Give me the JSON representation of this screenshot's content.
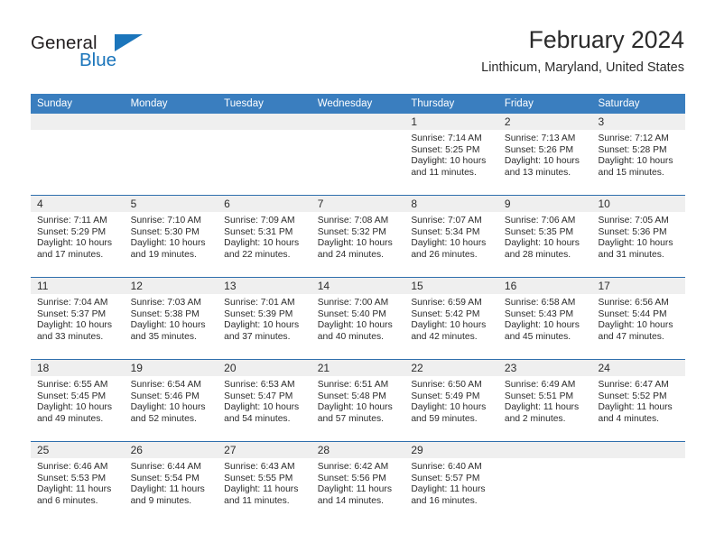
{
  "brand": {
    "name_primary": "General",
    "name_secondary": "Blue",
    "accent_color": "#1b75bb"
  },
  "header": {
    "title": "February 2024",
    "subtitle": "Linthicum, Maryland, United States"
  },
  "theme": {
    "header_row_bg": "#3a7ebf",
    "daynum_band_bg": "#efefef",
    "row_divider": "#2f6fad",
    "text_color": "#2b2b2b"
  },
  "calendar": {
    "weekday_headers": [
      "Sunday",
      "Monday",
      "Tuesday",
      "Wednesday",
      "Thursday",
      "Friday",
      "Saturday"
    ],
    "labels": {
      "sunrise": "Sunrise:",
      "sunset": "Sunset:",
      "daylight": "Daylight:"
    },
    "weeks": [
      [
        {
          "day": "",
          "sunrise": "",
          "sunset": "",
          "daylight_line1": "",
          "daylight_line2": ""
        },
        {
          "day": "",
          "sunrise": "",
          "sunset": "",
          "daylight_line1": "",
          "daylight_line2": ""
        },
        {
          "day": "",
          "sunrise": "",
          "sunset": "",
          "daylight_line1": "",
          "daylight_line2": ""
        },
        {
          "day": "",
          "sunrise": "",
          "sunset": "",
          "daylight_line1": "",
          "daylight_line2": ""
        },
        {
          "day": "1",
          "sunrise": "Sunrise: 7:14 AM",
          "sunset": "Sunset: 5:25 PM",
          "daylight_line1": "Daylight: 10 hours",
          "daylight_line2": "and 11 minutes."
        },
        {
          "day": "2",
          "sunrise": "Sunrise: 7:13 AM",
          "sunset": "Sunset: 5:26 PM",
          "daylight_line1": "Daylight: 10 hours",
          "daylight_line2": "and 13 minutes."
        },
        {
          "day": "3",
          "sunrise": "Sunrise: 7:12 AM",
          "sunset": "Sunset: 5:28 PM",
          "daylight_line1": "Daylight: 10 hours",
          "daylight_line2": "and 15 minutes."
        }
      ],
      [
        {
          "day": "4",
          "sunrise": "Sunrise: 7:11 AM",
          "sunset": "Sunset: 5:29 PM",
          "daylight_line1": "Daylight: 10 hours",
          "daylight_line2": "and 17 minutes."
        },
        {
          "day": "5",
          "sunrise": "Sunrise: 7:10 AM",
          "sunset": "Sunset: 5:30 PM",
          "daylight_line1": "Daylight: 10 hours",
          "daylight_line2": "and 19 minutes."
        },
        {
          "day": "6",
          "sunrise": "Sunrise: 7:09 AM",
          "sunset": "Sunset: 5:31 PM",
          "daylight_line1": "Daylight: 10 hours",
          "daylight_line2": "and 22 minutes."
        },
        {
          "day": "7",
          "sunrise": "Sunrise: 7:08 AM",
          "sunset": "Sunset: 5:32 PM",
          "daylight_line1": "Daylight: 10 hours",
          "daylight_line2": "and 24 minutes."
        },
        {
          "day": "8",
          "sunrise": "Sunrise: 7:07 AM",
          "sunset": "Sunset: 5:34 PM",
          "daylight_line1": "Daylight: 10 hours",
          "daylight_line2": "and 26 minutes."
        },
        {
          "day": "9",
          "sunrise": "Sunrise: 7:06 AM",
          "sunset": "Sunset: 5:35 PM",
          "daylight_line1": "Daylight: 10 hours",
          "daylight_line2": "and 28 minutes."
        },
        {
          "day": "10",
          "sunrise": "Sunrise: 7:05 AM",
          "sunset": "Sunset: 5:36 PM",
          "daylight_line1": "Daylight: 10 hours",
          "daylight_line2": "and 31 minutes."
        }
      ],
      [
        {
          "day": "11",
          "sunrise": "Sunrise: 7:04 AM",
          "sunset": "Sunset: 5:37 PM",
          "daylight_line1": "Daylight: 10 hours",
          "daylight_line2": "and 33 minutes."
        },
        {
          "day": "12",
          "sunrise": "Sunrise: 7:03 AM",
          "sunset": "Sunset: 5:38 PM",
          "daylight_line1": "Daylight: 10 hours",
          "daylight_line2": "and 35 minutes."
        },
        {
          "day": "13",
          "sunrise": "Sunrise: 7:01 AM",
          "sunset": "Sunset: 5:39 PM",
          "daylight_line1": "Daylight: 10 hours",
          "daylight_line2": "and 37 minutes."
        },
        {
          "day": "14",
          "sunrise": "Sunrise: 7:00 AM",
          "sunset": "Sunset: 5:40 PM",
          "daylight_line1": "Daylight: 10 hours",
          "daylight_line2": "and 40 minutes."
        },
        {
          "day": "15",
          "sunrise": "Sunrise: 6:59 AM",
          "sunset": "Sunset: 5:42 PM",
          "daylight_line1": "Daylight: 10 hours",
          "daylight_line2": "and 42 minutes."
        },
        {
          "day": "16",
          "sunrise": "Sunrise: 6:58 AM",
          "sunset": "Sunset: 5:43 PM",
          "daylight_line1": "Daylight: 10 hours",
          "daylight_line2": "and 45 minutes."
        },
        {
          "day": "17",
          "sunrise": "Sunrise: 6:56 AM",
          "sunset": "Sunset: 5:44 PM",
          "daylight_line1": "Daylight: 10 hours",
          "daylight_line2": "and 47 minutes."
        }
      ],
      [
        {
          "day": "18",
          "sunrise": "Sunrise: 6:55 AM",
          "sunset": "Sunset: 5:45 PM",
          "daylight_line1": "Daylight: 10 hours",
          "daylight_line2": "and 49 minutes."
        },
        {
          "day": "19",
          "sunrise": "Sunrise: 6:54 AM",
          "sunset": "Sunset: 5:46 PM",
          "daylight_line1": "Daylight: 10 hours",
          "daylight_line2": "and 52 minutes."
        },
        {
          "day": "20",
          "sunrise": "Sunrise: 6:53 AM",
          "sunset": "Sunset: 5:47 PM",
          "daylight_line1": "Daylight: 10 hours",
          "daylight_line2": "and 54 minutes."
        },
        {
          "day": "21",
          "sunrise": "Sunrise: 6:51 AM",
          "sunset": "Sunset: 5:48 PM",
          "daylight_line1": "Daylight: 10 hours",
          "daylight_line2": "and 57 minutes."
        },
        {
          "day": "22",
          "sunrise": "Sunrise: 6:50 AM",
          "sunset": "Sunset: 5:49 PM",
          "daylight_line1": "Daylight: 10 hours",
          "daylight_line2": "and 59 minutes."
        },
        {
          "day": "23",
          "sunrise": "Sunrise: 6:49 AM",
          "sunset": "Sunset: 5:51 PM",
          "daylight_line1": "Daylight: 11 hours",
          "daylight_line2": "and 2 minutes."
        },
        {
          "day": "24",
          "sunrise": "Sunrise: 6:47 AM",
          "sunset": "Sunset: 5:52 PM",
          "daylight_line1": "Daylight: 11 hours",
          "daylight_line2": "and 4 minutes."
        }
      ],
      [
        {
          "day": "25",
          "sunrise": "Sunrise: 6:46 AM",
          "sunset": "Sunset: 5:53 PM",
          "daylight_line1": "Daylight: 11 hours",
          "daylight_line2": "and 6 minutes."
        },
        {
          "day": "26",
          "sunrise": "Sunrise: 6:44 AM",
          "sunset": "Sunset: 5:54 PM",
          "daylight_line1": "Daylight: 11 hours",
          "daylight_line2": "and 9 minutes."
        },
        {
          "day": "27",
          "sunrise": "Sunrise: 6:43 AM",
          "sunset": "Sunset: 5:55 PM",
          "daylight_line1": "Daylight: 11 hours",
          "daylight_line2": "and 11 minutes."
        },
        {
          "day": "28",
          "sunrise": "Sunrise: 6:42 AM",
          "sunset": "Sunset: 5:56 PM",
          "daylight_line1": "Daylight: 11 hours",
          "daylight_line2": "and 14 minutes."
        },
        {
          "day": "29",
          "sunrise": "Sunrise: 6:40 AM",
          "sunset": "Sunset: 5:57 PM",
          "daylight_line1": "Daylight: 11 hours",
          "daylight_line2": "and 16 minutes."
        },
        {
          "day": "",
          "sunrise": "",
          "sunset": "",
          "daylight_line1": "",
          "daylight_line2": ""
        },
        {
          "day": "",
          "sunrise": "",
          "sunset": "",
          "daylight_line1": "",
          "daylight_line2": ""
        }
      ]
    ]
  }
}
